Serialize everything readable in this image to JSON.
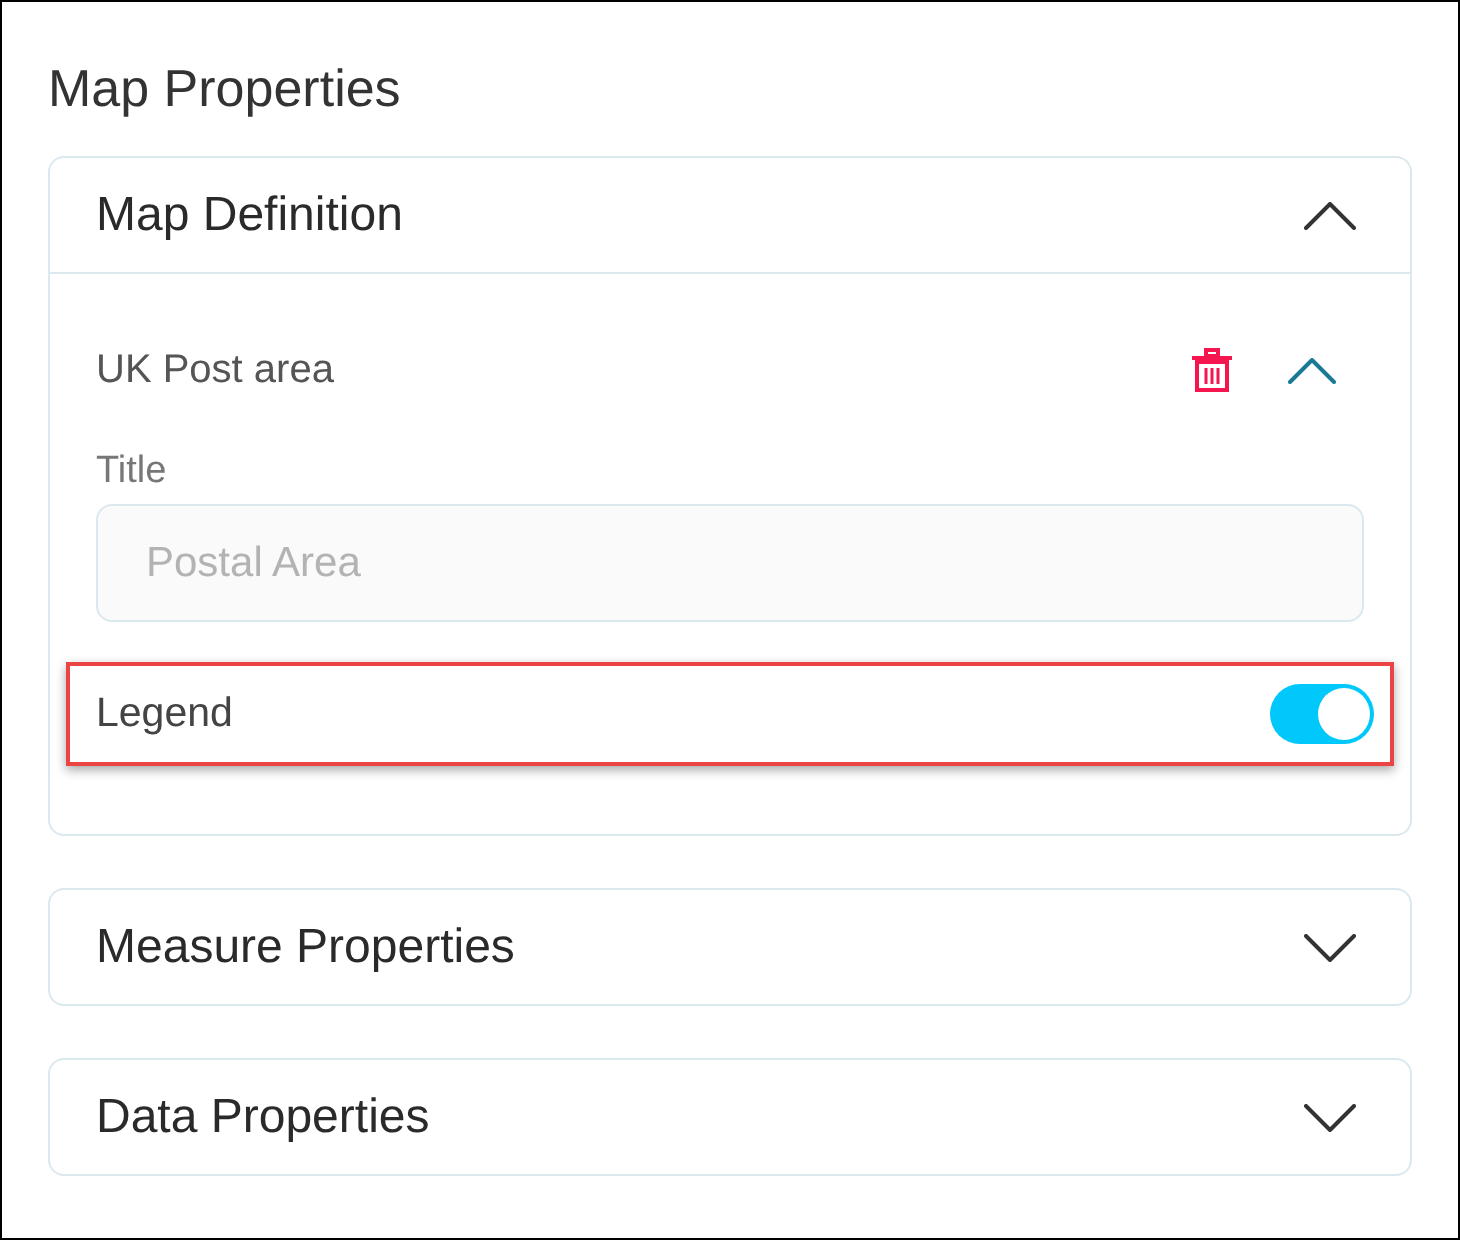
{
  "panel": {
    "title": "Map Properties"
  },
  "sections": [
    {
      "title": "Map Definition",
      "expanded": true,
      "layers": [
        {
          "name": "UK Post area",
          "expanded": true,
          "fields": [
            {
              "kind": "text",
              "label": "Title",
              "placeholder": "Postal Area"
            },
            {
              "kind": "toggle",
              "label": "Legend",
              "on": true,
              "highlighted": true
            }
          ]
        }
      ]
    },
    {
      "title": "Measure Properties",
      "expanded": false
    },
    {
      "title": "Data Properties",
      "expanded": false
    }
  ]
}
